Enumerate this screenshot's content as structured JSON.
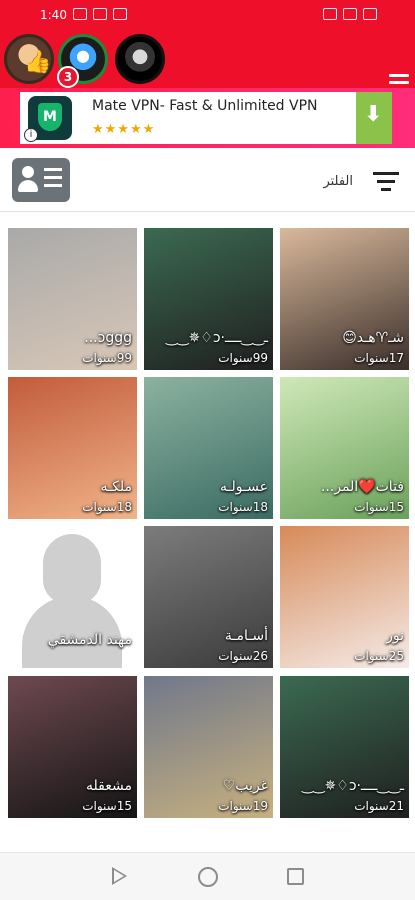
{
  "status": {
    "left_time": "1:40",
    "right_signal": "full"
  },
  "header": {
    "avatars": [
      {
        "name": "profile-avatar-1",
        "icon": "thumbs-up-icon"
      },
      {
        "name": "profile-avatar-2",
        "badge": "3",
        "icon": "speaker-icon"
      },
      {
        "name": "profile-avatar-3"
      }
    ],
    "menu_icon": "hamburger-icon"
  },
  "ad": {
    "title": "Mate VPN- Fast & Unlimited VPN",
    "logo_letter": "M",
    "rating_stars": 4.5,
    "info_icon": "info-icon",
    "action_icon": "download-icon"
  },
  "toolbar": {
    "filter_label": "الفلتر",
    "profile_icon": "profile-card-icon",
    "filter_icon": "filter-icon"
  },
  "users": [
    {
      "name": "",
      "age": "17سنوات",
      "label": "شـ♈هـد😊",
      "colors": [
        "#d9b99b",
        "#3a2e2a"
      ]
    },
    {
      "name": "",
      "age": "99سنوات",
      "label": "ـ‿‿ــــ·ɔ♢✵‿‿",
      "colors": [
        "#3b6a51",
        "#1f1f1f"
      ]
    },
    {
      "name": "",
      "age": "99سنوات",
      "label": "ɔggg...",
      "colors": [
        "#a9a9a9",
        "#d8c7b7"
      ]
    },
    {
      "name": "",
      "age": "15سنوات",
      "label": "فتات❤️المر...",
      "colors": [
        "#cfe8b8",
        "#6aa15b"
      ]
    },
    {
      "name": "",
      "age": "18سنوات",
      "label": "عسـولـه",
      "colors": [
        "#8cb2a0",
        "#3b6b63"
      ]
    },
    {
      "name": "",
      "age": "18سنوات",
      "label": "ملكـه",
      "colors": [
        "#c25b3b",
        "#f0b48a"
      ]
    },
    {
      "name": "",
      "age": "25سنوات",
      "label": "نور",
      "colors": [
        "#d78a59",
        "#f4ebe7"
      ]
    },
    {
      "name": "",
      "age": "26سنوات",
      "label": "أسـامـة",
      "colors": [
        "#7c7c7c",
        "#3b3b3b"
      ]
    },
    {
      "name": "",
      "age": "",
      "label": "مهند الدمشقي",
      "colors": [
        "#e9e9e9",
        "#e0e0e0"
      ]
    },
    {
      "name": "",
      "age": "21سنوات",
      "label": "ـ‿‿ــــ·ɔ♢✵‿‿",
      "colors": [
        "#3b6a51",
        "#1f1f1f"
      ]
    },
    {
      "name": "",
      "age": "19سنوات",
      "label": "غريب♡",
      "colors": [
        "#70788a",
        "#c7b07f"
      ]
    },
    {
      "name": "",
      "age": "15سنوات",
      "label": "مشعقله",
      "colors": [
        "#6e4950",
        "#141414"
      ]
    }
  ],
  "nav": {
    "back_icon": "back-triangle-icon",
    "home_icon": "home-circle-icon",
    "recent_icon": "recents-square-icon"
  }
}
